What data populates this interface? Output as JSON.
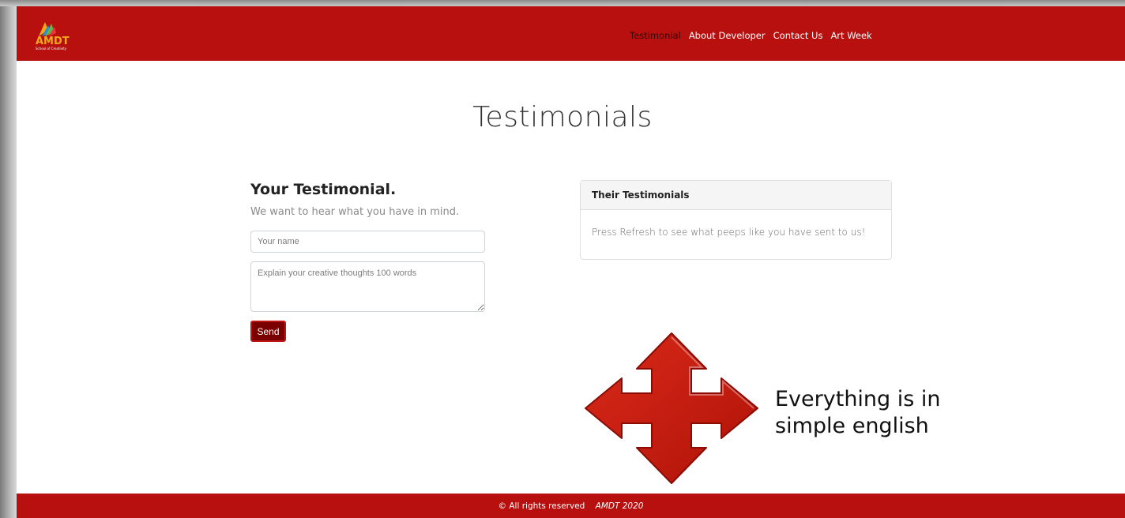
{
  "nav": {
    "logo_text": "AMDT",
    "logo_subtext": "School of Creativity",
    "links": [
      "Testimonial",
      "About Developer",
      "Contact Us",
      "Art Week"
    ],
    "active_index": 0
  },
  "page": {
    "title": "Testimonials"
  },
  "form": {
    "heading": "Your Testimonial.",
    "lead": "We want to hear what you have in mind.",
    "name_placeholder": "Your name",
    "message_placeholder": "Explain your creative thoughts 100 words",
    "send_label": "Send"
  },
  "card": {
    "header": "Their Testimonials",
    "body": "Press Refresh to see what peeps like you have sent to us!"
  },
  "annotation": {
    "line1": "Everything is in",
    "line2": "simple english",
    "arrow_color": "#c8190c"
  },
  "footer": {
    "copyright": "© All rights reserved",
    "brand": "AMDT 2020"
  },
  "colors": {
    "brand_red": "#b80f0f",
    "button_red": "#7a0000"
  }
}
